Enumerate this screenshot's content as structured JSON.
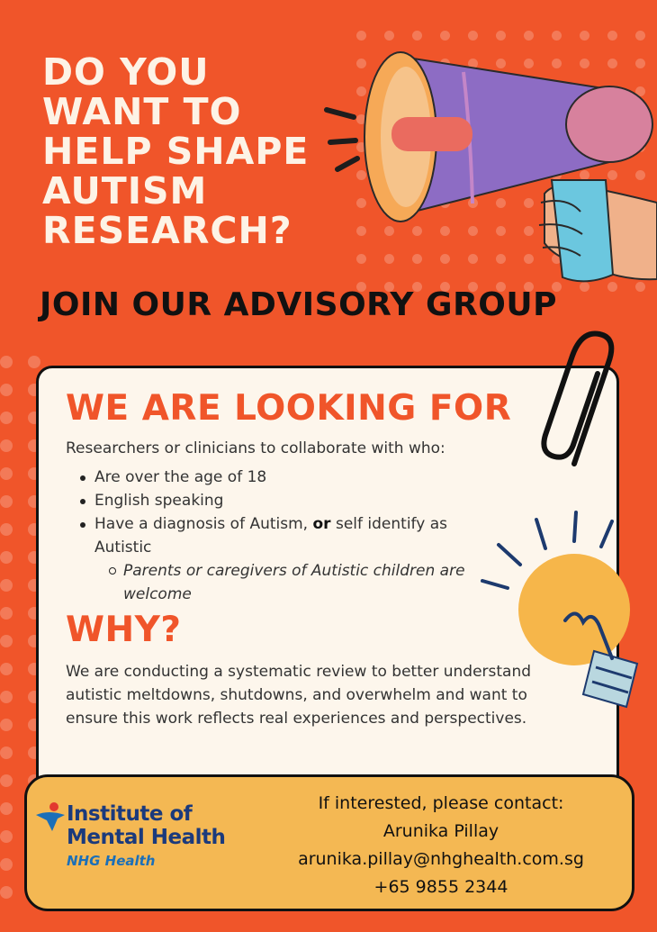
{
  "headline": [
    "DO YOU",
    "WANT TO",
    "HELP SHAPE",
    "AUTISM",
    "RESEARCH?"
  ],
  "subheadline": "JOIN OUR ADVISORY GROUP",
  "looking_for": {
    "title": "WE ARE LOOKING FOR",
    "intro": "Researchers or clinicians to collaborate with who:",
    "bullets": [
      "Are over the age of 18",
      "English speaking"
    ],
    "bullet3": {
      "pre": "Have a diagnosis of Autism, ",
      "bold": "or",
      "post": " self identify as Autistic"
    },
    "sub_bullet": "Parents or caregivers of Autistic children are welcome"
  },
  "why": {
    "title": "WHY?",
    "body": "We are conducting a systematic review to better understand autistic meltdowns, shutdowns, and overwhelm and want to ensure this work reflects real experiences and perspectives."
  },
  "footer": {
    "logo_line1": "Institute of",
    "logo_line2": "Mental Health",
    "logo_sub": "NHG Health",
    "contact_label": "If interested, please contact:",
    "contact_name": "Arunika Pillay",
    "contact_email": "arunika.pillay@nhghealth.com.sg",
    "contact_phone": "+65 9855 2344"
  },
  "colors": {
    "background": "#f0552a",
    "headline": "#fdf3e6",
    "card": "#fdf6ec",
    "footer": "#f4b853",
    "logo": "#1b3a7c"
  },
  "icons": [
    "megaphone-icon",
    "paperclip-icon",
    "lightbulb-icon"
  ]
}
